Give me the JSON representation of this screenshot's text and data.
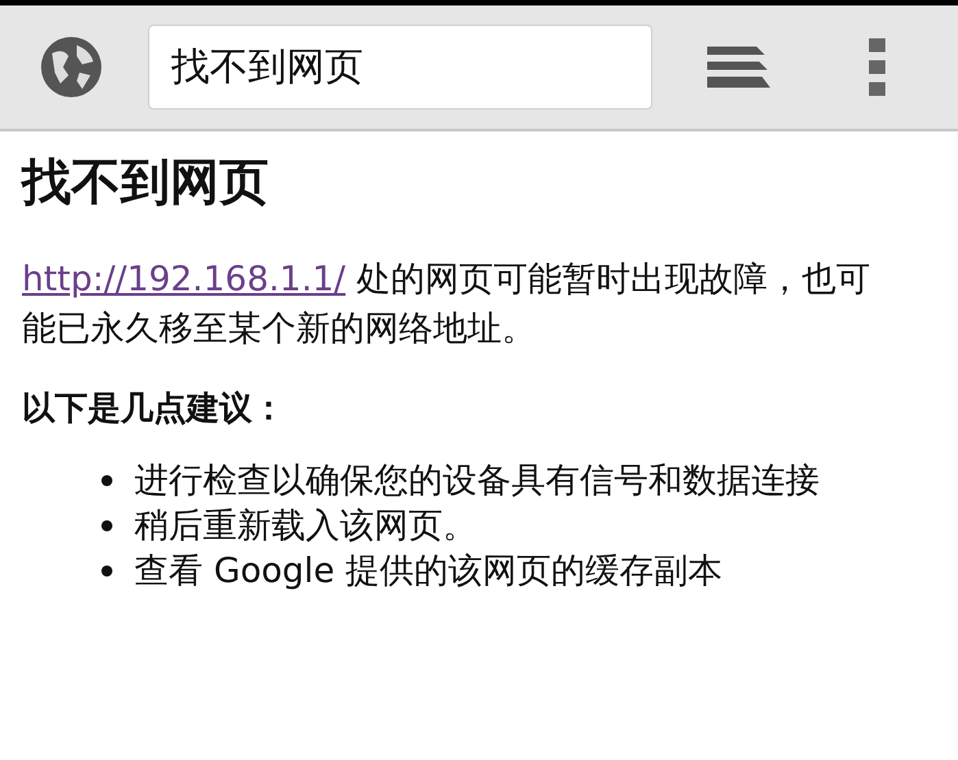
{
  "toolbar": {
    "address": "找不到网页"
  },
  "page": {
    "title": "找不到网页",
    "message": {
      "link": "http://192.168.1.1/",
      "text": " 处的网页可能暂时出现故障，也可能已永久移至某个新的网络地址。"
    },
    "suggestions_heading": "以下是几点建议：",
    "suggestions": [
      "进行检查以确保您的设备具有信号和数据连接",
      "稍后重新载入该网页。",
      "查看 Google 提供的该网页的缓存副本"
    ]
  }
}
